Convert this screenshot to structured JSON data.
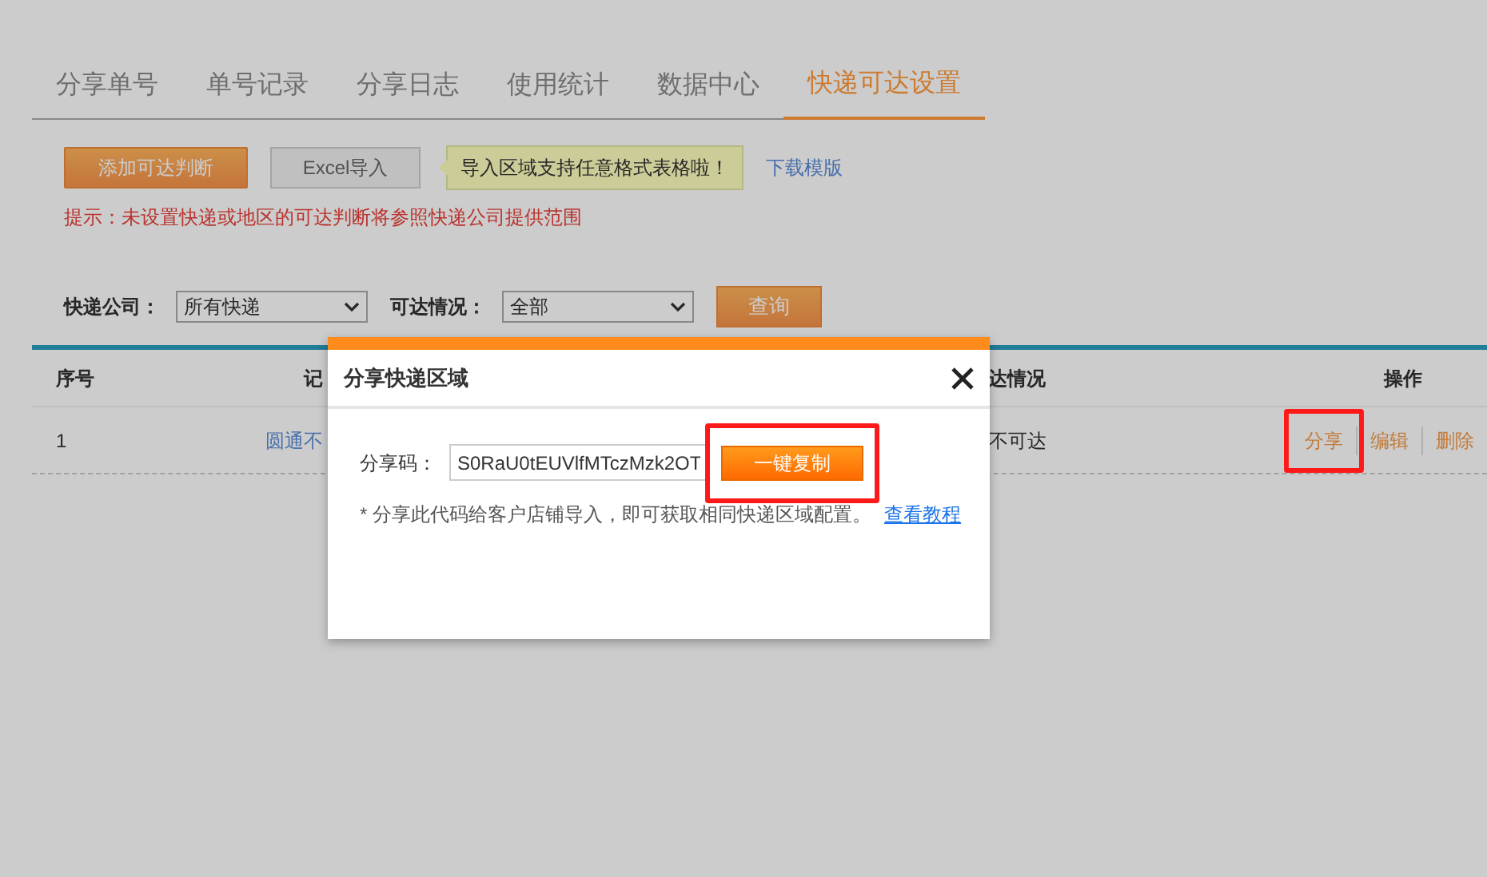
{
  "tabs": [
    {
      "label": "分享单号",
      "selected": false
    },
    {
      "label": "单号记录",
      "selected": false
    },
    {
      "label": "分享日志",
      "selected": false
    },
    {
      "label": "使用统计",
      "selected": false
    },
    {
      "label": "数据中心",
      "selected": false
    },
    {
      "label": "快递可达设置",
      "selected": true
    }
  ],
  "toolbar": {
    "add_button": "添加可达判断",
    "import_button": "Excel导入",
    "tooltip": "导入区域支持任意格式表格啦！",
    "template_link": "下载模版"
  },
  "notice": "提示：未设置快递或地区的可达判断将参照快递公司提供范围",
  "filters": [
    {
      "label": "快递公司：",
      "value": "所有快递"
    },
    {
      "label": "可达情况：",
      "value": "全部"
    }
  ],
  "query_button": "查询",
  "table": {
    "columns": [
      "序号",
      "记",
      "达情况",
      "操作"
    ],
    "rows": [
      {
        "cells": [
          "1",
          "圆通不",
          "不可达"
        ],
        "actions": [
          {
            "label": "分享",
            "highlighted": true
          },
          {
            "label": "编辑",
            "highlighted": false
          },
          {
            "label": "删除",
            "highlighted": false
          }
        ]
      }
    ]
  },
  "dialog": {
    "title": "分享快递区域",
    "code_label": "分享码：",
    "code_value": "S0RaU0tEUVlfMTczMzk2OT",
    "copy_button": "一键复制",
    "copy_highlighted": true,
    "note": "* 分享此代码给客户店铺导入，即可获取相同快递区域配置。",
    "tutorial_link": "查看教程"
  }
}
